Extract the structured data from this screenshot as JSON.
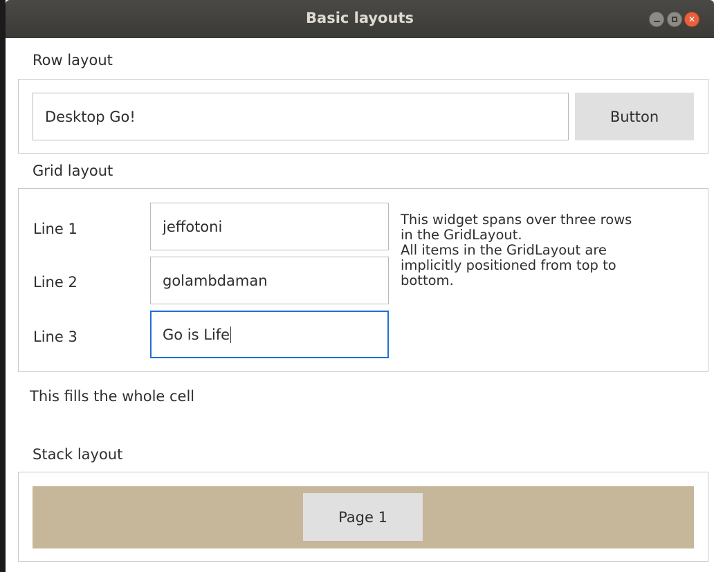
{
  "window": {
    "title": "Basic layouts"
  },
  "row_layout": {
    "label": "Row layout",
    "text_field_value": "Desktop Go!",
    "button_label": "Button"
  },
  "grid_layout": {
    "label": "Grid layout",
    "rows": [
      {
        "label": "Line 1",
        "value": "jeffotoni"
      },
      {
        "label": "Line 2",
        "value": "golambdaman"
      },
      {
        "label": "Line 3",
        "value": "Go is Life"
      }
    ],
    "span_text": "This widget spans over three rows\nin the GridLayout.\nAll items in the GridLayout are\nimplicitly positioned from top to\nbottom."
  },
  "fill_text": "This fills the whole cell",
  "stack_layout": {
    "label": "Stack layout",
    "page_button_label": "Page 1",
    "page_background": "#c6b79a"
  }
}
